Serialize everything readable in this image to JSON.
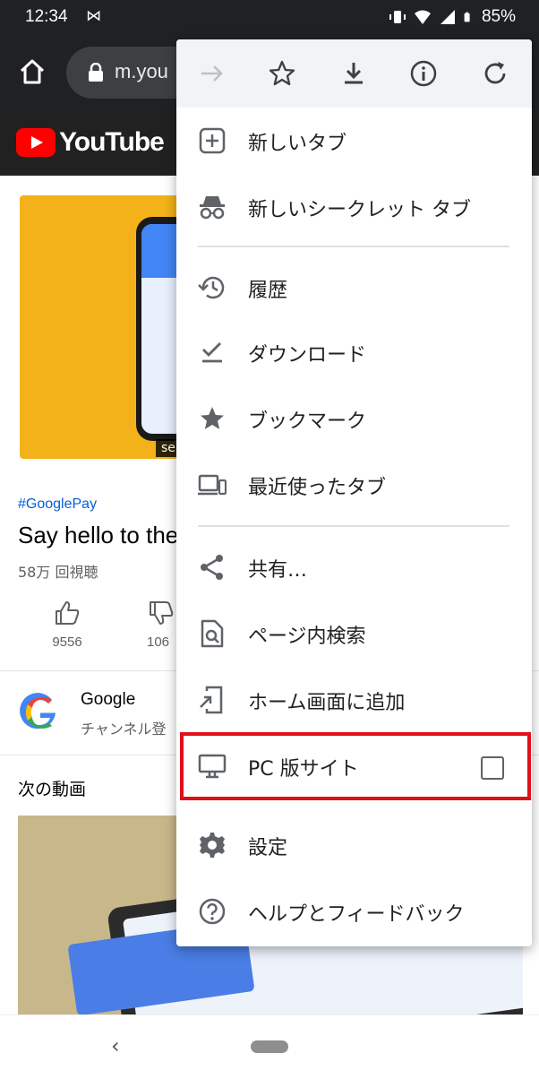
{
  "status_bar": {
    "time": "12:34",
    "battery": "85%"
  },
  "browser": {
    "url": "m.you"
  },
  "youtube": {
    "logo_text": "YouTube",
    "thumbnail_badge": "se",
    "hashtag": "#GooglePay",
    "title": "Say hello to the",
    "views": "58万 回視聴",
    "likes": "9556",
    "dislikes": "106",
    "channel_name": "Google",
    "channel_sub": "チャンネル登",
    "next_videos_label": "次の動画"
  },
  "menu": {
    "top_icons": [
      "forward-icon",
      "star-icon",
      "download-icon",
      "info-icon",
      "refresh-icon"
    ],
    "items": [
      {
        "label": "新しいタブ",
        "icon": "new-tab-icon"
      },
      {
        "label": "新しいシークレット タブ",
        "icon": "incognito-icon"
      },
      {
        "label": "履歴",
        "icon": "history-icon"
      },
      {
        "label": "ダウンロード",
        "icon": "downloads-icon"
      },
      {
        "label": "ブックマーク",
        "icon": "bookmark-star-icon"
      },
      {
        "label": "最近使ったタブ",
        "icon": "recent-tabs-icon"
      },
      {
        "label": "共有…",
        "icon": "share-icon"
      },
      {
        "label": "ページ内検索",
        "icon": "find-in-page-icon"
      },
      {
        "label": "ホーム画面に追加",
        "icon": "add-to-home-icon"
      },
      {
        "label": "PC 版サイト",
        "icon": "desktop-icon"
      },
      {
        "label": "設定",
        "icon": "settings-gear-icon"
      },
      {
        "label": "ヘルプとフィードバック",
        "icon": "help-icon"
      }
    ],
    "desktop_site_checked": false
  },
  "colors": {
    "toolbar_bg": "#202124",
    "highlight": "#e0101a",
    "youtube_red": "#ff0000",
    "thumbnail_yellow": "#f3b21a"
  }
}
